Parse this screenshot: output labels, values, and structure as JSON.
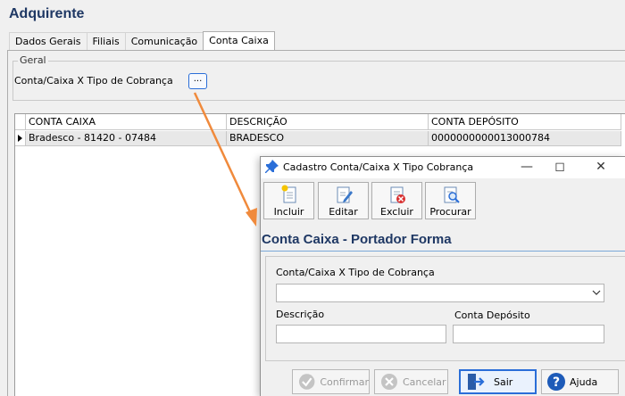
{
  "main": {
    "title": "Adquirente",
    "tabs": [
      {
        "label": "Dados Gerais"
      },
      {
        "label": "Filiais"
      },
      {
        "label": "Comunicação"
      },
      {
        "label": "Conta Caixa",
        "active": true
      }
    ],
    "group_label": "Geral",
    "field_label": "Conta/Caixa X Tipo de Cobrança",
    "lookup_button_label": "...",
    "grid": {
      "columns": [
        "CONTA CAIXA",
        "DESCRIÇÃO",
        "CONTA DEPÓSITO"
      ],
      "rows": [
        [
          "Bradesco - 81420 - 07484",
          "BRADESCO",
          "0000000000013000784"
        ]
      ]
    }
  },
  "dialog": {
    "title": "Cadastro Conta/Caixa X Tipo Cobrança",
    "toolbar": {
      "incluir": "Incluir",
      "editar": "Editar",
      "excluir": "Excluir",
      "procurar": "Procurar"
    },
    "heading": "Conta Caixa - Portador Forma",
    "combo_label": "Conta/Caixa X Tipo de Cobrança",
    "combo_value": "",
    "descricao_label": "Descrição",
    "descricao_value": "",
    "conta_deposito_label": "Conta Depósito",
    "conta_deposito_value": "",
    "footer": {
      "confirmar": "Confirmar",
      "cancelar": "Cancelar",
      "sair": "Sair",
      "ajuda": "Ajuda"
    }
  },
  "colors": {
    "title_blue": "#1f3864",
    "focus_blue": "#2a6ed8",
    "arrow_orange": "#f08a3c"
  }
}
